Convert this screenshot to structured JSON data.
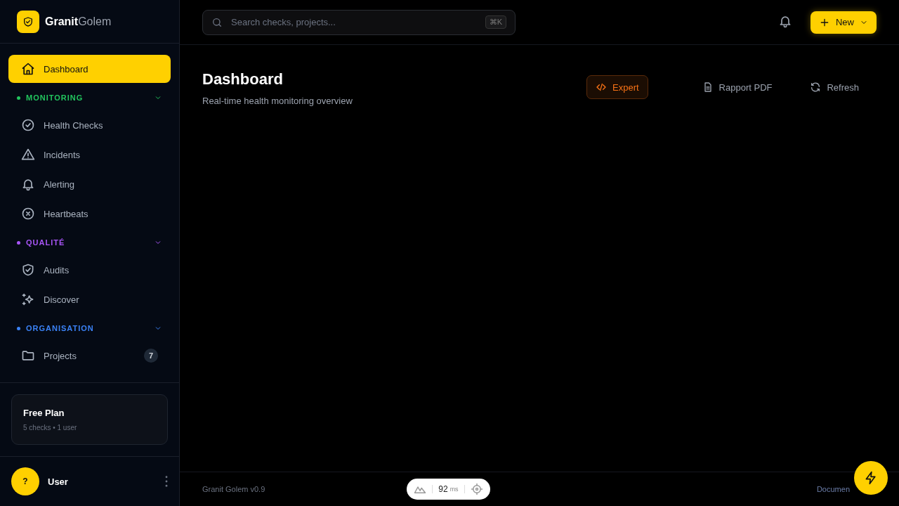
{
  "brand": {
    "bold": "Granit",
    "light": "Golem"
  },
  "sidebar": {
    "top_item": {
      "label": "Dashboard",
      "selected": true
    },
    "sections": [
      {
        "label": "MONITORING",
        "color": "#22c55e",
        "expanded": true,
        "items": [
          {
            "label": "Health Checks",
            "selected": false
          },
          {
            "label": "Incidents",
            "selected": false
          },
          {
            "label": "Alerting",
            "selected": false
          },
          {
            "label": "Heartbeats",
            "selected": false
          }
        ]
      },
      {
        "label": "QUALITÉ",
        "color": "#a855f7",
        "expanded": true,
        "items": [
          {
            "label": "Audits",
            "selected": false
          },
          {
            "label": "Discover",
            "selected": false
          }
        ]
      },
      {
        "label": "ORGANISATION",
        "color": "#3b82f6",
        "expanded": true,
        "items": [
          {
            "label": "Projects",
            "selected": false,
            "badge": "7"
          }
        ]
      }
    ],
    "plan": {
      "title": "Free Plan",
      "detail": "5 checks • 1 user"
    },
    "user": {
      "avatar": "?",
      "name": "User"
    }
  },
  "search": {
    "placeholder": "Search checks, projects...",
    "shortcut": "⌘K"
  },
  "new_button": "New",
  "page": {
    "title": "Dashboard",
    "subtitle": "Real-time health monitoring overview",
    "actions": [
      {
        "label": "Expert",
        "kind": "accent"
      },
      {
        "label": "Rapport PDF",
        "kind": "plain"
      },
      {
        "label": "Refresh",
        "kind": "plain"
      }
    ]
  },
  "footer": {
    "version": "Granit Golem v0.9",
    "latency": "92",
    "unit": "ms",
    "link": "Documen"
  }
}
